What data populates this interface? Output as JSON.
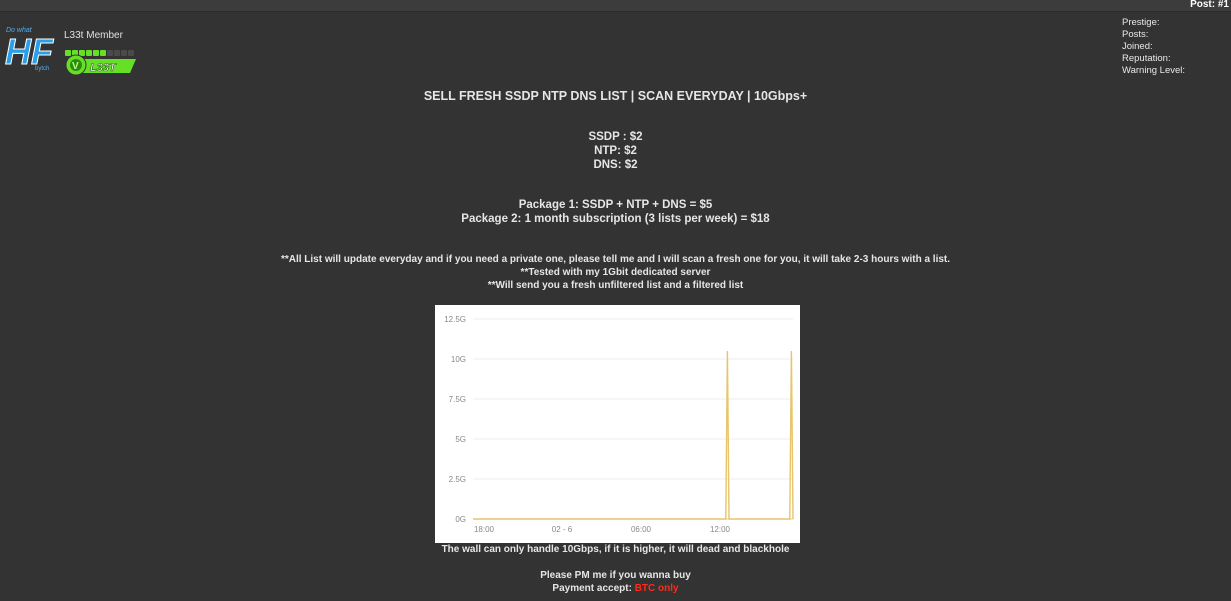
{
  "header": {
    "post_number": "Post: #1"
  },
  "user": {
    "logo_text": "HF",
    "rank": "L33t Member",
    "reputation_level": 6,
    "reputation_max": 10,
    "badge_text": "L33T",
    "accent": "#66e026"
  },
  "stats": {
    "prestige": "Prestige:",
    "posts": "Posts:",
    "joined": "Joined:",
    "reputation": "Reputation:",
    "warning": "Warning Level:"
  },
  "post": {
    "title": "SELL FRESH SSDP NTP DNS LIST | SCAN EVERYDAY | 10Gbps+",
    "price_ssdp": "SSDP : $2",
    "price_ntp": "NTP: $2",
    "price_dns": "DNS: $2",
    "package1": "Package 1: SSDP + NTP + DNS = $5",
    "package2": "Package 2: 1 month subscription (3 lists per week) = $18",
    "note1": "**All List will update everyday and if you need a private one, please tell me and I will scan a fresh one for you, it will take 2-3 hours with a list.",
    "note2": "**Tested with my 1Gbit dedicated server",
    "note3": "**Will send you a fresh unfiltered list and a filtered list",
    "caption": "The wall can only handle 10Gbps, if it is higher, it will dead and blackhole",
    "pm": "Please PM me if you wanna buy",
    "payment_label": "Payment accept: ",
    "payment_value": "BTC only",
    "payment_color": "#ff2a1a"
  },
  "chart_data": {
    "type": "line",
    "x_ticks": [
      "18:00",
      "02 - 6",
      "06:00",
      "12:00"
    ],
    "y_ticks": [
      "0G",
      "2.5G",
      "5G",
      "7.5G",
      "10G",
      "12.5G"
    ],
    "ylim": [
      0,
      12.5
    ],
    "grid": true,
    "series": [
      {
        "color": "#e8c46a",
        "x": [
          0,
          0.79,
          0.795,
          0.8,
          0.99,
          0.995,
          1.0
        ],
        "values": [
          0,
          0,
          10.5,
          0,
          0,
          10.5,
          0
        ]
      }
    ]
  }
}
